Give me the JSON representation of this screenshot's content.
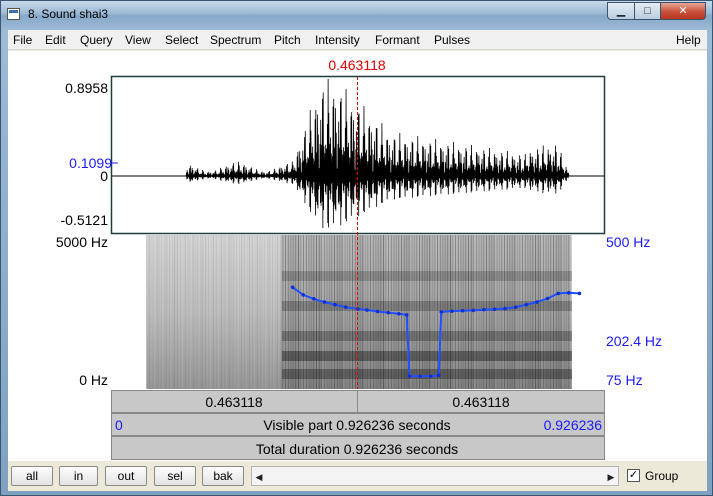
{
  "window": {
    "title": "8. Sound shai3",
    "minimize_glyph": "▁",
    "maximize_glyph": "□",
    "close_glyph": "✕",
    "icon": "praat-window-icon"
  },
  "menu": [
    "File",
    "Edit",
    "Query",
    "View",
    "Select",
    "Spectrum",
    "Pitch",
    "Intensity",
    "Formant",
    "Pulses"
  ],
  "help": "Help",
  "cursor_time": "0.463118",
  "waveform": {
    "max_label": "0.8958",
    "cursor_value_label": "0.1099",
    "zero_label": "0",
    "min_label": "-0.5121"
  },
  "spectrogram": {
    "top_freq_label": "5000 Hz",
    "bottom_freq_label": "0 Hz"
  },
  "pitch_axis": {
    "top_label": "500 Hz",
    "cursor_label": "202.4 Hz",
    "bottom_label": "75 Hz"
  },
  "selection_bar": {
    "left_duration": "0.463118",
    "right_duration": "0.463118"
  },
  "visible_bar": {
    "start": "0",
    "label": "Visible part 0.926236 seconds",
    "end": "0.926236"
  },
  "total_bar": {
    "label": "Total duration 0.926236 seconds"
  },
  "toolbar": {
    "buttons": [
      "all",
      "in",
      "out",
      "sel",
      "bak"
    ],
    "group_label": "Group",
    "group_checked": true,
    "check_glyph": "✓",
    "scroll_left": "◀",
    "scroll_right": "▶"
  },
  "colors": {
    "cursor": "#e00000",
    "pitch": "#2050ff",
    "pitch_dots": "#1030d0",
    "axis_blue": "#1a1aff",
    "frame": "#1d3d3d"
  },
  "pitch_contour": {
    "t": [
      0.34,
      0.36,
      0.38,
      0.4,
      0.42,
      0.44,
      0.463,
      0.48,
      0.5,
      0.52,
      0.54,
      0.555,
      0.56,
      0.58,
      0.6,
      0.615,
      0.62,
      0.64,
      0.66,
      0.68,
      0.7,
      0.72,
      0.74,
      0.76,
      0.78,
      0.8,
      0.82,
      0.84,
      0.86,
      0.88
    ],
    "hz": [
      272,
      245,
      232,
      222,
      214,
      207,
      202,
      199,
      195,
      192,
      189,
      186,
      80,
      80,
      80,
      81,
      194,
      196,
      197,
      198,
      200,
      201,
      203,
      207,
      214,
      222,
      233,
      250,
      252,
      250
    ]
  }
}
